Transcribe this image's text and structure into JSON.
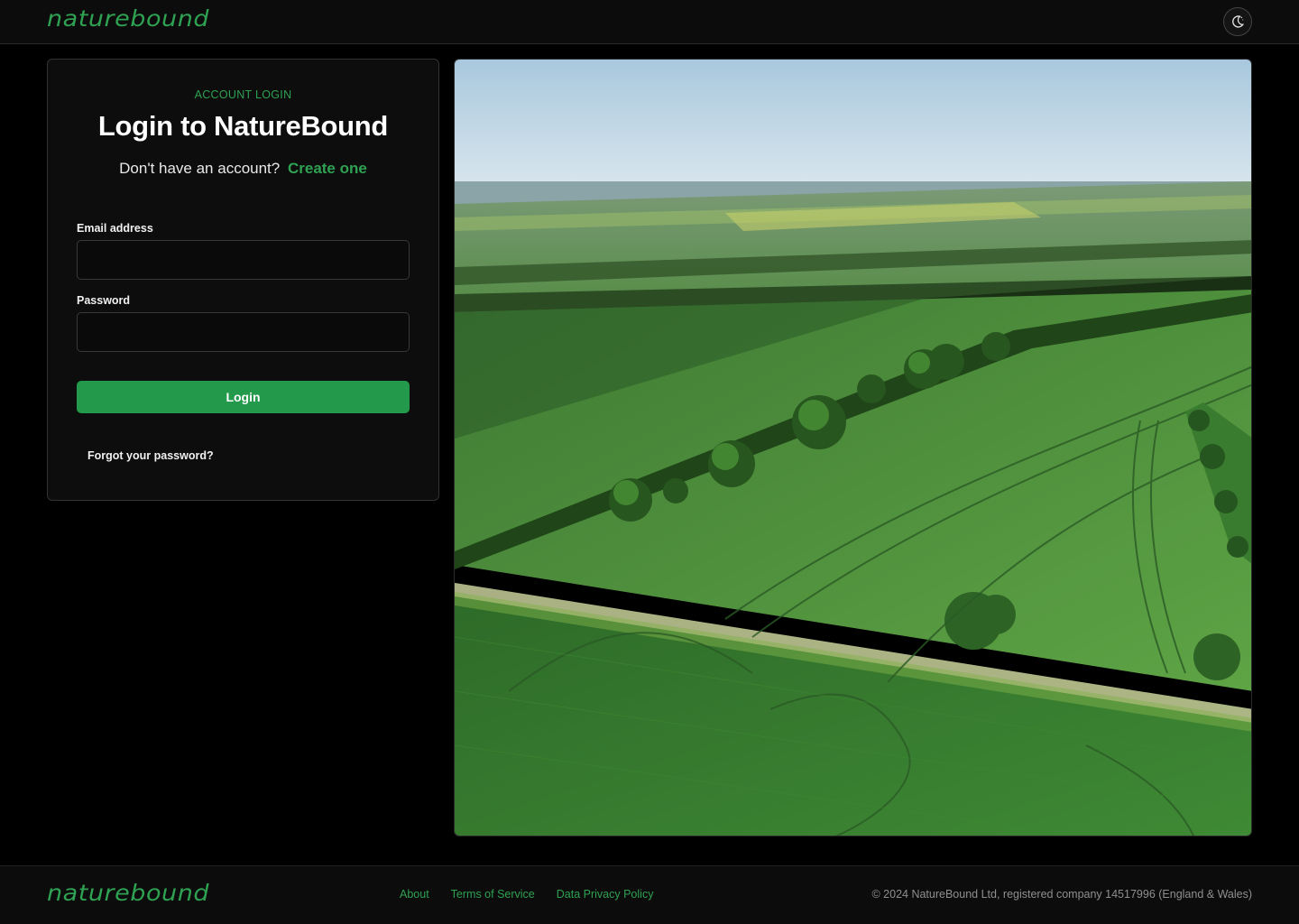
{
  "header": {
    "logo_text": "naturebound",
    "theme_toggle_icon": "moon-icon"
  },
  "login": {
    "eyebrow": "ACCOUNT LOGIN",
    "title": "Login to NatureBound",
    "no_account_text": "Don't have an account?",
    "create_link": "Create one",
    "email_label": "Email address",
    "email_value": "",
    "email_placeholder": "",
    "password_label": "Password",
    "password_value": "",
    "password_placeholder": "",
    "login_button": "Login",
    "forgot_link": "Forgot your password?"
  },
  "hero": {
    "image_subject": "aerial view of green farm fields"
  },
  "footer": {
    "logo_text": "naturebound",
    "links": [
      "About",
      "Terms of Service",
      "Data Privacy Policy"
    ],
    "copyright": "© 2024 NatureBound Ltd, registered company 14517996 (England & Wales)"
  },
  "colors": {
    "accent": "#22994b",
    "accent_text": "#2fa152",
    "background": "#000000",
    "surface": "#0e0d0d"
  }
}
